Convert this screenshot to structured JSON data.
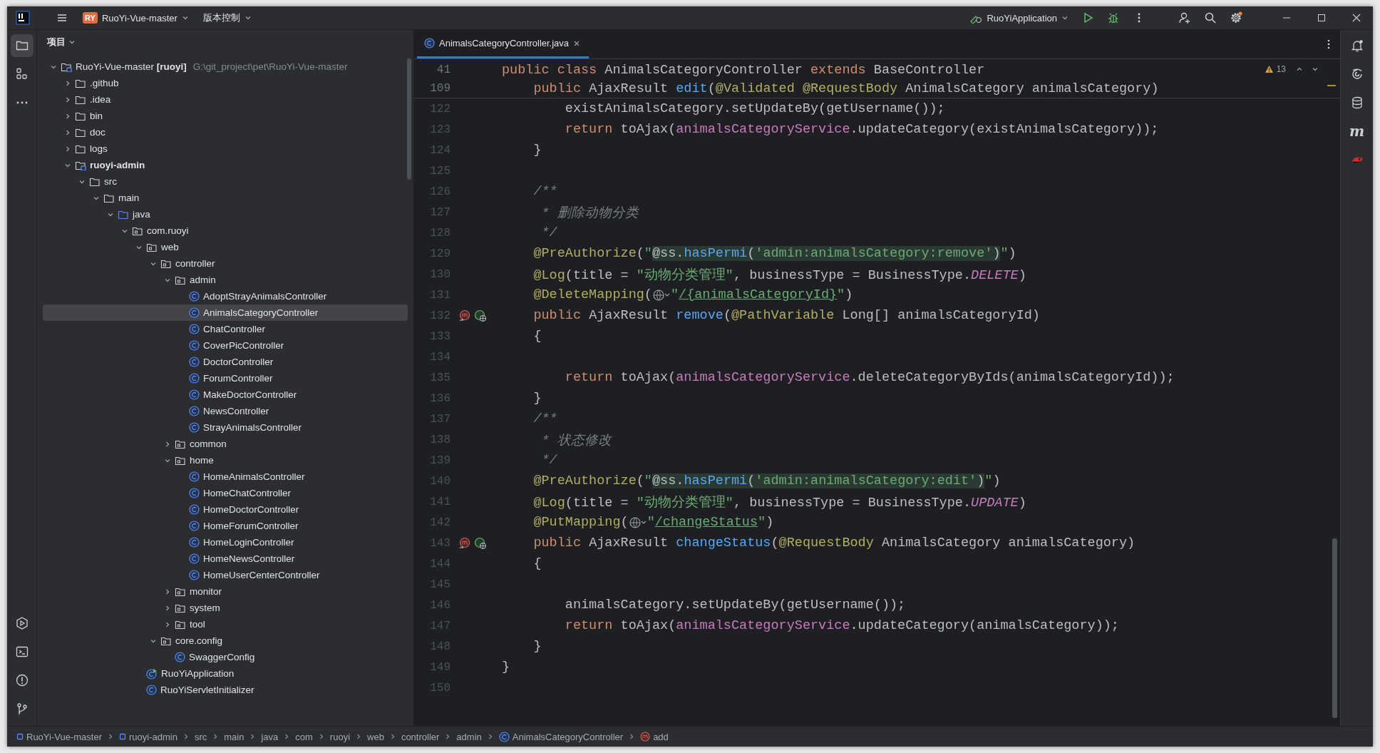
{
  "title_bar": {
    "project_badge": "RY",
    "project": "RuoYi-Vue-master",
    "vcs": "版本控制",
    "run_config": "RuoYiApplication"
  },
  "left_tools": [
    {
      "kind": "project",
      "selected": true
    },
    {
      "kind": "structure",
      "selected": false
    },
    {
      "kind": "more",
      "selected": false
    }
  ],
  "left_tools_bottom": [
    {
      "kind": "services",
      "selected": false
    },
    {
      "kind": "terminal",
      "selected": false
    },
    {
      "kind": "problems",
      "selected": false
    },
    {
      "kind": "git",
      "selected": false
    }
  ],
  "right_tools": [
    {
      "kind": "notifications"
    },
    {
      "kind": "ai"
    },
    {
      "kind": "database"
    },
    {
      "kind": "maven",
      "label": "m"
    },
    {
      "kind": "plugin"
    }
  ],
  "project_panel": {
    "title": "项目",
    "tree": [
      {
        "label": "RuoYi-Vue-master",
        "tag": "[ruoyi]",
        "path": "G:\\git_project\\pet\\RuoYi-Vue-master",
        "kind": "module",
        "expanded": true,
        "selected": false,
        "children": [
          {
            "label": ".github",
            "kind": "folder",
            "expanded": false,
            "selected": false
          },
          {
            "label": ".idea",
            "kind": "folder",
            "expanded": false,
            "selected": false
          },
          {
            "label": "bin",
            "kind": "folder",
            "expanded": false,
            "selected": false
          },
          {
            "label": "doc",
            "kind": "folder",
            "expanded": false,
            "selected": false
          },
          {
            "label": "logs",
            "kind": "folder",
            "expanded": false,
            "selected": false
          },
          {
            "label": "ruoyi-admin",
            "kind": "module",
            "bold": true,
            "expanded": true,
            "selected": false,
            "children": [
              {
                "label": "src",
                "kind": "folder",
                "expanded": true,
                "selected": false,
                "children": [
                  {
                    "label": "main",
                    "kind": "folder",
                    "expanded": true,
                    "selected": false,
                    "children": [
                      {
                        "label": "java",
                        "kind": "source-root",
                        "expanded": true,
                        "selected": false,
                        "children": [
                          {
                            "label": "com.ruoyi",
                            "kind": "package",
                            "expanded": true,
                            "selected": false,
                            "children": [
                              {
                                "label": "web",
                                "kind": "package",
                                "expanded": true,
                                "selected": false,
                                "children": [
                                  {
                                    "label": "controller",
                                    "kind": "package",
                                    "expanded": true,
                                    "selected": false,
                                    "children": [
                                      {
                                        "label": "admin",
                                        "kind": "package",
                                        "expanded": true,
                                        "selected": false,
                                        "children": [
                                          {
                                            "label": "AdoptStrayAnimalsController",
                                            "kind": "class",
                                            "selected": false
                                          },
                                          {
                                            "label": "AnimalsCategoryController",
                                            "kind": "class",
                                            "selected": true
                                          },
                                          {
                                            "label": "ChatController",
                                            "kind": "class",
                                            "selected": false
                                          },
                                          {
                                            "label": "CoverPicController",
                                            "kind": "class",
                                            "selected": false
                                          },
                                          {
                                            "label": "DoctorController",
                                            "kind": "class",
                                            "selected": false
                                          },
                                          {
                                            "label": "ForumController",
                                            "kind": "class",
                                            "selected": false
                                          },
                                          {
                                            "label": "MakeDoctorController",
                                            "kind": "class",
                                            "selected": false
                                          },
                                          {
                                            "label": "NewsController",
                                            "kind": "class",
                                            "selected": false
                                          },
                                          {
                                            "label": "StrayAnimalsController",
                                            "kind": "class",
                                            "selected": false
                                          }
                                        ]
                                      },
                                      {
                                        "label": "common",
                                        "kind": "package",
                                        "expanded": false,
                                        "selected": false
                                      },
                                      {
                                        "label": "home",
                                        "kind": "package",
                                        "expanded": true,
                                        "selected": false,
                                        "children": [
                                          {
                                            "label": "HomeAnimalsController",
                                            "kind": "class",
                                            "selected": false
                                          },
                                          {
                                            "label": "HomeChatController",
                                            "kind": "class",
                                            "selected": false
                                          },
                                          {
                                            "label": "HomeDoctorController",
                                            "kind": "class",
                                            "selected": false
                                          },
                                          {
                                            "label": "HomeForumController",
                                            "kind": "class",
                                            "selected": false
                                          },
                                          {
                                            "label": "HomeLoginController",
                                            "kind": "class",
                                            "selected": false
                                          },
                                          {
                                            "label": "HomeNewsController",
                                            "kind": "class",
                                            "selected": false
                                          },
                                          {
                                            "label": "HomeUserCenterController",
                                            "kind": "class",
                                            "selected": false
                                          }
                                        ]
                                      },
                                      {
                                        "label": "monitor",
                                        "kind": "package",
                                        "expanded": false,
                                        "selected": false
                                      },
                                      {
                                        "label": "system",
                                        "kind": "package",
                                        "expanded": false,
                                        "selected": false
                                      },
                                      {
                                        "label": "tool",
                                        "kind": "package",
                                        "expanded": false,
                                        "selected": false
                                      }
                                    ]
                                  },
                                  {
                                    "label": "core.config",
                                    "kind": "package",
                                    "expanded": true,
                                    "selected": false,
                                    "children": [
                                      {
                                        "label": "SwaggerConfig",
                                        "kind": "class",
                                        "selected": false
                                      }
                                    ]
                                  }
                                ]
                              },
                              {
                                "label": "RuoYiApplication",
                                "kind": "app-class",
                                "selected": false
                              },
                              {
                                "label": "RuoYiServletInitializer",
                                "kind": "class",
                                "selected": false
                              }
                            ]
                          }
                        ]
                      }
                    ]
                  }
                ]
              }
            ]
          }
        ]
      }
    ]
  },
  "editor": {
    "tabs": [
      {
        "label": "AnimalsCategoryController.java",
        "selected": true
      }
    ],
    "warnings": "13",
    "lines": [
      {
        "number": "41",
        "sticky": true,
        "tokens": [
          {
            "kind": "keyword",
            "text": "public class "
          },
          {
            "kind": "plain",
            "text": "AnimalsCategoryController "
          },
          {
            "kind": "keyword",
            "text": "extends "
          },
          {
            "kind": "plain",
            "text": "BaseController"
          }
        ]
      },
      {
        "number": "109",
        "sticky": true,
        "tokens": [
          {
            "kind": "keyword",
            "text": "    public "
          },
          {
            "kind": "plain",
            "text": "AjaxResult "
          },
          {
            "kind": "method",
            "text": "edit"
          },
          {
            "kind": "plain",
            "text": "("
          },
          {
            "kind": "annotation",
            "text": "@Validated @RequestBody "
          },
          {
            "kind": "plain",
            "text": "AnimalsCategory animalsCategory)"
          }
        ]
      },
      {
        "number": "122",
        "tokens": [
          {
            "kind": "plain",
            "text": "        existAnimalsCategory.setUpdateBy(getUsername());"
          }
        ]
      },
      {
        "number": "123",
        "tokens": [
          {
            "kind": "keyword",
            "text": "        return "
          },
          {
            "kind": "plain",
            "text": "toAjax("
          },
          {
            "kind": "field",
            "text": "animalsCategoryService"
          },
          {
            "kind": "plain",
            "text": ".updateCategory(existAnimalsCategory));"
          }
        ]
      },
      {
        "number": "124",
        "tokens": [
          {
            "kind": "plain",
            "text": "    }"
          }
        ]
      },
      {
        "number": "125"
      },
      {
        "number": "126",
        "tokens": [
          {
            "kind": "comment",
            "text": "    /**"
          }
        ]
      },
      {
        "number": "127",
        "tokens": [
          {
            "kind": "comment",
            "text": "     * 删除动物分类"
          }
        ]
      },
      {
        "number": "128",
        "tokens": [
          {
            "kind": "comment",
            "text": "     */"
          }
        ]
      },
      {
        "number": "129",
        "tokens": [
          {
            "kind": "annotation",
            "text": "    @PreAuthorize"
          },
          {
            "kind": "plain",
            "text": "("
          },
          {
            "kind": "string",
            "text": "\""
          },
          {
            "kind": "spel-plain",
            "text": "@ss."
          },
          {
            "kind": "spel-method",
            "text": "hasPermi"
          },
          {
            "kind": "spel-plain",
            "text": "("
          },
          {
            "kind": "spel-string",
            "text": "'admin:animalsCategory:remove'"
          },
          {
            "kind": "spel-plain",
            "text": ")"
          },
          {
            "kind": "string",
            "text": "\""
          },
          {
            "kind": "plain",
            "text": ")"
          }
        ]
      },
      {
        "number": "130",
        "tokens": [
          {
            "kind": "annotation",
            "text": "    @Log"
          },
          {
            "kind": "plain",
            "text": "(title = "
          },
          {
            "kind": "string",
            "text": "\"动物分类管理\""
          },
          {
            "kind": "plain",
            "text": ", businessType = BusinessType."
          },
          {
            "kind": "constant",
            "text": "DELETE"
          },
          {
            "kind": "plain",
            "text": ")"
          }
        ]
      },
      {
        "number": "131",
        "tokens": [
          {
            "kind": "annotation",
            "text": "    @DeleteMapping"
          },
          {
            "kind": "plain",
            "text": "("
          },
          {
            "kind": "globe"
          },
          {
            "kind": "string",
            "text": "\""
          },
          {
            "kind": "url",
            "text": "/{animalsCategoryId}"
          },
          {
            "kind": "string",
            "text": "\""
          },
          {
            "kind": "plain",
            "text": ")"
          }
        ]
      },
      {
        "number": "132",
        "gutter_icons": true,
        "tokens": [
          {
            "kind": "keyword",
            "text": "    public "
          },
          {
            "kind": "plain",
            "text": "AjaxResult "
          },
          {
            "kind": "method",
            "text": "remove"
          },
          {
            "kind": "plain",
            "text": "("
          },
          {
            "kind": "annotation",
            "text": "@PathVariable "
          },
          {
            "kind": "plain",
            "text": "Long[] animalsCategoryId)"
          }
        ]
      },
      {
        "number": "133",
        "tokens": [
          {
            "kind": "plain",
            "text": "    {"
          }
        ]
      },
      {
        "number": "134"
      },
      {
        "number": "135",
        "tokens": [
          {
            "kind": "keyword",
            "text": "        return "
          },
          {
            "kind": "plain",
            "text": "toAjax("
          },
          {
            "kind": "field",
            "text": "animalsCategoryService"
          },
          {
            "kind": "plain",
            "text": ".deleteCategoryByIds(animalsCategoryId));"
          }
        ]
      },
      {
        "number": "136",
        "tokens": [
          {
            "kind": "plain",
            "text": "    }"
          }
        ]
      },
      {
        "number": "137",
        "tokens": [
          {
            "kind": "comment",
            "text": "    /**"
          }
        ]
      },
      {
        "number": "138",
        "tokens": [
          {
            "kind": "comment",
            "text": "     * 状态修改"
          }
        ]
      },
      {
        "number": "139",
        "tokens": [
          {
            "kind": "comment",
            "text": "     */"
          }
        ]
      },
      {
        "number": "140",
        "tokens": [
          {
            "kind": "annotation",
            "text": "    @PreAuthorize"
          },
          {
            "kind": "plain",
            "text": "("
          },
          {
            "kind": "string",
            "text": "\""
          },
          {
            "kind": "spel-plain",
            "text": "@ss."
          },
          {
            "kind": "spel-method",
            "text": "hasPermi"
          },
          {
            "kind": "spel-plain",
            "text": "("
          },
          {
            "kind": "spel-string",
            "text": "'admin:animalsCategory:edit'"
          },
          {
            "kind": "spel-plain",
            "text": ")"
          },
          {
            "kind": "string",
            "text": "\""
          },
          {
            "kind": "plain",
            "text": ")"
          }
        ]
      },
      {
        "number": "141",
        "tokens": [
          {
            "kind": "annotation",
            "text": "    @Log"
          },
          {
            "kind": "plain",
            "text": "(title = "
          },
          {
            "kind": "string",
            "text": "\"动物分类管理\""
          },
          {
            "kind": "plain",
            "text": ", businessType = BusinessType."
          },
          {
            "kind": "constant",
            "text": "UPDATE"
          },
          {
            "kind": "plain",
            "text": ")"
          }
        ]
      },
      {
        "number": "142",
        "tokens": [
          {
            "kind": "annotation",
            "text": "    @PutMapping"
          },
          {
            "kind": "plain",
            "text": "("
          },
          {
            "kind": "globe"
          },
          {
            "kind": "string",
            "text": "\""
          },
          {
            "kind": "url",
            "text": "/changeStatus"
          },
          {
            "kind": "string",
            "text": "\""
          },
          {
            "kind": "plain",
            "text": ")"
          }
        ]
      },
      {
        "number": "143",
        "gutter_icons": true,
        "tokens": [
          {
            "kind": "keyword",
            "text": "    public "
          },
          {
            "kind": "plain",
            "text": "AjaxResult "
          },
          {
            "kind": "method",
            "text": "changeStatus"
          },
          {
            "kind": "plain",
            "text": "("
          },
          {
            "kind": "annotation",
            "text": "@RequestBody "
          },
          {
            "kind": "plain",
            "text": "AnimalsCategory animalsCategory)"
          }
        ]
      },
      {
        "number": "144",
        "tokens": [
          {
            "kind": "plain",
            "text": "    {"
          }
        ]
      },
      {
        "number": "145"
      },
      {
        "number": "146",
        "tokens": [
          {
            "kind": "plain",
            "text": "        animalsCategory.setUpdateBy(getUsername());"
          }
        ]
      },
      {
        "number": "147",
        "tokens": [
          {
            "kind": "keyword",
            "text": "        return "
          },
          {
            "kind": "plain",
            "text": "toAjax("
          },
          {
            "kind": "field",
            "text": "animalsCategoryService"
          },
          {
            "kind": "plain",
            "text": ".updateCategory(animalsCategory));"
          }
        ]
      },
      {
        "number": "148",
        "tokens": [
          {
            "kind": "plain",
            "text": "    }"
          }
        ]
      },
      {
        "number": "149",
        "tokens": [
          {
            "kind": "plain",
            "text": "}"
          }
        ]
      },
      {
        "number": "150"
      }
    ]
  },
  "breadcrumbs": [
    {
      "label": "RuoYi-Vue-master",
      "kind": "module"
    },
    {
      "label": "ruoyi-admin",
      "kind": "module"
    },
    {
      "label": "src",
      "kind": "folder"
    },
    {
      "label": "main",
      "kind": "folder"
    },
    {
      "label": "java",
      "kind": "folder"
    },
    {
      "label": "com",
      "kind": "folder"
    },
    {
      "label": "ruoyi",
      "kind": "folder"
    },
    {
      "label": "web",
      "kind": "folder"
    },
    {
      "label": "controller",
      "kind": "folder"
    },
    {
      "label": "admin",
      "kind": "folder"
    },
    {
      "label": "AnimalsCategoryController",
      "kind": "class"
    },
    {
      "label": "add",
      "kind": "method"
    }
  ]
}
